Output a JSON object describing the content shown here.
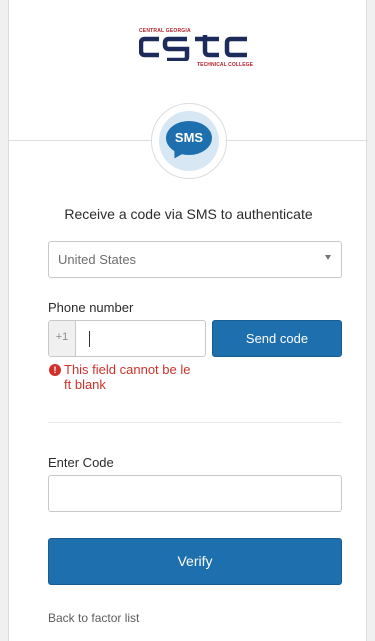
{
  "logo": {
    "top_text": "CENTRAL GEORGIA",
    "wordmark": "cgtc",
    "bottom_text": "TECHNICAL COLLEGE",
    "colors": {
      "navy": "#1c2a5c",
      "red": "#b4202a"
    }
  },
  "factor": {
    "badge_label": "SMS",
    "icon": "sms-chat-bubble-icon",
    "title": "Receive a code via SMS to authenticate"
  },
  "country": {
    "selected": "United States"
  },
  "phone": {
    "label": "Phone number",
    "prefix": "+1",
    "value": "",
    "send_label": "Send code",
    "error_line1": "This field cannot be le",
    "error_line2": "ft blank",
    "error_icon": "exclamation-circle-icon"
  },
  "code": {
    "label": "Enter Code",
    "value": ""
  },
  "actions": {
    "verify_label": "Verify",
    "back_link": "Back to factor list"
  },
  "colors": {
    "primary": "#1d6fae",
    "error": "#d0322b",
    "badge_bg": "#d7e7f3"
  }
}
